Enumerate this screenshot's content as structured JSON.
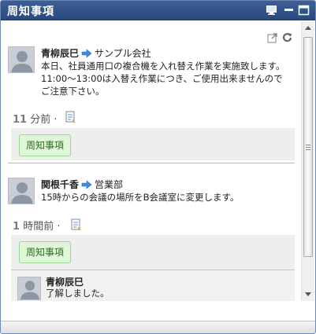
{
  "window": {
    "title": "周知事項"
  },
  "posts": [
    {
      "author": "青柳辰巳",
      "target": "サンプル会社",
      "message_lines": [
        "本日、社員通用口の複合機を入れ替え作業を実施致します。",
        "11:00～13:00は入替え作業につき、ご使用出来ませんので",
        "ご注意下さい。"
      ],
      "time_num": "11",
      "time_unit": "分前",
      "tag": "周知事項"
    },
    {
      "author": "関根千香",
      "target": "営業部",
      "message_lines": [
        "15時からの会議の場所をB会議室に変更します。"
      ],
      "time_num": "1",
      "time_unit": "時間前",
      "tag": "周知事項",
      "reply": {
        "author": "青柳辰巳",
        "message": "了解しました。"
      }
    }
  ],
  "icons": {
    "monitor": "monitor-icon",
    "minimize": "minimize-icon",
    "maximize": "maximize-icon",
    "popout": "popout-icon",
    "refresh": "refresh-icon",
    "comment": "comment-icon",
    "arrow": "arrow-right-icon"
  },
  "colors": {
    "titlebar": "#2f5189",
    "tag_bg": "#dff6d8",
    "tag_border": "#98d890",
    "arrow": "#3a8ee6"
  }
}
